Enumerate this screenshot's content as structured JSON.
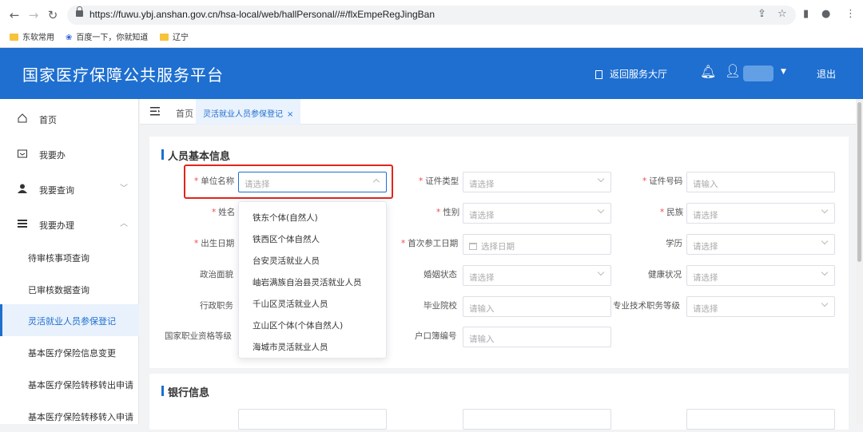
{
  "browser": {
    "url": "https://fuwu.ybj.anshan.gov.cn/hsa-local/web/hallPersonal//#/flxEmpeRegJingBan",
    "bookmarks": [
      "东软常用",
      "百度一下，你就知道",
      "辽宁"
    ]
  },
  "header": {
    "title": "国家医疗保障公共服务平台",
    "back_to_hall": "返回服务大厅",
    "logout": "退出"
  },
  "sidebar": {
    "items": [
      {
        "label": "首页"
      },
      {
        "label": "我要办"
      },
      {
        "label": "我要查询"
      },
      {
        "label": "我要办理"
      }
    ],
    "sub_items": [
      {
        "label": "待审核事项查询"
      },
      {
        "label": "已审核数据查询"
      },
      {
        "label": "灵活就业人员参保登记"
      },
      {
        "label": "基本医疗保险信息变更"
      },
      {
        "label": "基本医疗保险转移转出申请"
      },
      {
        "label": "基本医疗保险转移转入申请"
      }
    ]
  },
  "tabs": {
    "home": "首页",
    "active": "灵活就业人员参保登记",
    "close": "×"
  },
  "form": {
    "section_basic": "人员基本信息",
    "section_bank": "银行信息",
    "fields": {
      "unit_name": {
        "label": "单位名称",
        "placeholder": "请选择"
      },
      "cert_type": {
        "label": "证件类型",
        "placeholder": "请选择"
      },
      "cert_no": {
        "label": "证件号码",
        "placeholder": "请输入"
      },
      "name": {
        "label": "姓名"
      },
      "gender": {
        "label": "性别",
        "placeholder": "请选择"
      },
      "nation": {
        "label": "民族",
        "placeholder": "请选择"
      },
      "birth_date": {
        "label": "出生日期"
      },
      "first_work_date": {
        "label": "首次参工日期",
        "placeholder": "选择日期"
      },
      "education": {
        "label": "学历",
        "placeholder": "请选择"
      },
      "political": {
        "label": "政治面貌"
      },
      "marital": {
        "label": "婚姻状态",
        "placeholder": "请选择"
      },
      "health": {
        "label": "健康状况",
        "placeholder": "请选择"
      },
      "admin_post": {
        "label": "行政职务"
      },
      "school": {
        "label": "毕业院校",
        "placeholder": "请输入"
      },
      "tech_post": {
        "label": "专业技术职务等级",
        "placeholder": "请选择"
      },
      "national_qual": {
        "label": "国家职业资格等级"
      },
      "hukou_no": {
        "label": "户口簿编号",
        "placeholder": "请输入"
      }
    }
  },
  "dropdown": {
    "options": [
      "铁东个体(自然人)",
      "铁西区个体自然人",
      "台安灵活就业人员",
      "岫岩满族自治县灵活就业人员",
      "千山区灵活就业人员",
      "立山区个体(个体自然人)",
      "海城市灵活就业人员"
    ]
  },
  "colors": {
    "brand": "#1e6fd0",
    "required": "#f24a4a",
    "highlight": "#e1251b"
  }
}
